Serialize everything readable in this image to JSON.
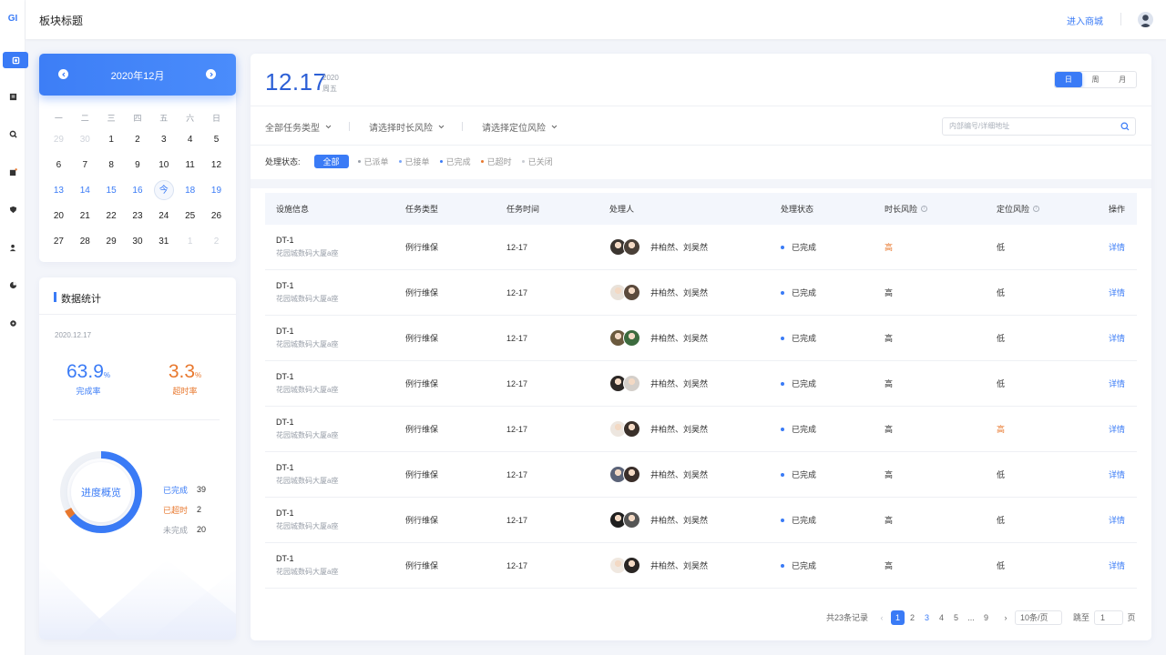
{
  "rail": {
    "logo": "GI"
  },
  "topbar": {
    "title": "板块标题",
    "shop_link": "进入商城"
  },
  "calendar": {
    "month_label": "2020年12月",
    "weekdays": [
      "一",
      "二",
      "三",
      "四",
      "五",
      "六",
      "日"
    ],
    "weeks": [
      [
        [
          "29",
          "muted"
        ],
        [
          "30",
          "muted"
        ],
        [
          "1",
          ""
        ],
        [
          "2",
          ""
        ],
        [
          "3",
          ""
        ],
        [
          "4",
          ""
        ],
        [
          "5",
          ""
        ]
      ],
      [
        [
          "6",
          ""
        ],
        [
          "7",
          ""
        ],
        [
          "8",
          ""
        ],
        [
          "9",
          ""
        ],
        [
          "10",
          ""
        ],
        [
          "11",
          ""
        ],
        [
          "12",
          ""
        ]
      ],
      [
        [
          "13",
          "cur"
        ],
        [
          "14",
          "cur"
        ],
        [
          "15",
          "cur"
        ],
        [
          "16",
          "cur"
        ],
        [
          "今",
          "today"
        ],
        [
          "18",
          "cur"
        ],
        [
          "19",
          "cur"
        ]
      ],
      [
        [
          "20",
          ""
        ],
        [
          "21",
          ""
        ],
        [
          "22",
          ""
        ],
        [
          "23",
          ""
        ],
        [
          "24",
          ""
        ],
        [
          "25",
          ""
        ],
        [
          "26",
          ""
        ]
      ],
      [
        [
          "27",
          ""
        ],
        [
          "28",
          ""
        ],
        [
          "29",
          ""
        ],
        [
          "30",
          ""
        ],
        [
          "31",
          ""
        ],
        [
          "1",
          "muted"
        ],
        [
          "2",
          "muted"
        ]
      ]
    ]
  },
  "stats": {
    "title": "数据统计",
    "date": "2020.12.17",
    "completion": {
      "value": "63.9",
      "unit": "%",
      "label": "完成率",
      "color": "#3a7bf6"
    },
    "overtime": {
      "value": "3.3",
      "unit": "%",
      "label": "超时率",
      "color": "#e8782e"
    },
    "donut_label": "进度概览",
    "legend": [
      {
        "label": "已完成",
        "value": "39",
        "color": "#3a7bf6"
      },
      {
        "label": "已超时",
        "value": "2",
        "color": "#e8782e"
      },
      {
        "label": "未完成",
        "value": "20",
        "color": "#9aa0aa"
      }
    ]
  },
  "main": {
    "date": "12.17",
    "year": "2020",
    "weekday": "周五",
    "view_tabs": [
      {
        "label": "日",
        "active": true
      },
      {
        "label": "周",
        "active": false
      },
      {
        "label": "月",
        "active": false
      }
    ],
    "filters": [
      "全部任务类型",
      "请选择时长风险",
      "请选择定位风险"
    ],
    "search_placeholder": "内部编号/详细地址",
    "status_label": "处理状态:",
    "status_chips": [
      {
        "label": "全部",
        "active": true,
        "color": "#3a7bf6"
      },
      {
        "label": "已派单",
        "active": false,
        "color": "#9aa0aa"
      },
      {
        "label": "已接单",
        "active": false,
        "color": "#7ba6f8"
      },
      {
        "label": "已完成",
        "active": false,
        "color": "#3a7bf6"
      },
      {
        "label": "已超时",
        "active": false,
        "color": "#e8782e"
      },
      {
        "label": "已关闭",
        "active": false,
        "color": "#c9ccd2"
      }
    ],
    "table": {
      "headers": [
        "设施信息",
        "任务类型",
        "任务时间",
        "处理人",
        "处理状态",
        "时长风险",
        "定位风险",
        "操作"
      ],
      "rows": [
        {
          "code": "DT-1",
          "addr": "花园城数码大厦a座",
          "type": "例行维保",
          "time": "12-17",
          "handlers": "井柏然、刘昊然",
          "status": "已完成",
          "dur_risk": "高",
          "dur_hl": true,
          "loc_risk": "低",
          "loc_hl": false,
          "action": "详情"
        },
        {
          "code": "DT-1",
          "addr": "花园城数码大厦a座",
          "type": "例行维保",
          "time": "12-17",
          "handlers": "井柏然、刘昊然",
          "status": "已完成",
          "dur_risk": "高",
          "dur_hl": false,
          "loc_risk": "低",
          "loc_hl": false,
          "action": "详情"
        },
        {
          "code": "DT-1",
          "addr": "花园城数码大厦a座",
          "type": "例行维保",
          "time": "12-17",
          "handlers": "井柏然、刘昊然",
          "status": "已完成",
          "dur_risk": "高",
          "dur_hl": false,
          "loc_risk": "低",
          "loc_hl": false,
          "action": "详情"
        },
        {
          "code": "DT-1",
          "addr": "花园城数码大厦a座",
          "type": "例行维保",
          "time": "12-17",
          "handlers": "井柏然、刘昊然",
          "status": "已完成",
          "dur_risk": "高",
          "dur_hl": false,
          "loc_risk": "低",
          "loc_hl": false,
          "action": "详情"
        },
        {
          "code": "DT-1",
          "addr": "花园城数码大厦a座",
          "type": "例行维保",
          "time": "12-17",
          "handlers": "井柏然、刘昊然",
          "status": "已完成",
          "dur_risk": "高",
          "dur_hl": false,
          "loc_risk": "高",
          "loc_hl": true,
          "action": "详情"
        },
        {
          "code": "DT-1",
          "addr": "花园城数码大厦a座",
          "type": "例行维保",
          "time": "12-17",
          "handlers": "井柏然、刘昊然",
          "status": "已完成",
          "dur_risk": "高",
          "dur_hl": false,
          "loc_risk": "低",
          "loc_hl": false,
          "action": "详情"
        },
        {
          "code": "DT-1",
          "addr": "花园城数码大厦a座",
          "type": "例行维保",
          "time": "12-17",
          "handlers": "井柏然、刘昊然",
          "status": "已完成",
          "dur_risk": "高",
          "dur_hl": false,
          "loc_risk": "低",
          "loc_hl": false,
          "action": "详情"
        },
        {
          "code": "DT-1",
          "addr": "花园城数码大厦a座",
          "type": "例行维保",
          "time": "12-17",
          "handlers": "井柏然、刘昊然",
          "status": "已完成",
          "dur_risk": "高",
          "dur_hl": false,
          "loc_risk": "低",
          "loc_hl": false,
          "action": "详情"
        }
      ]
    },
    "pager": {
      "total": "共23条记录",
      "pages": [
        "1",
        "2",
        "3",
        "4",
        "5",
        "...",
        "9"
      ],
      "current": "1",
      "page_size": "10条/页",
      "jump_label": "跳至",
      "jump_value": "1",
      "page_unit": "页"
    }
  }
}
